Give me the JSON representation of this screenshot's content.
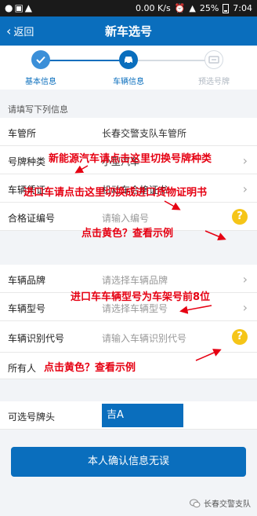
{
  "status_bar": {
    "left_icons": "●▣▲",
    "speed": "0.00 K/s",
    "battery": "25%",
    "time": "7:04"
  },
  "nav": {
    "back_label": "返回",
    "title": "新车选号"
  },
  "steps": [
    {
      "label": "基本信息",
      "state": "done"
    },
    {
      "label": "车辆信息",
      "state": "active"
    },
    {
      "label": "预选号牌",
      "state": "pending"
    }
  ],
  "section_title": "请填写下列信息",
  "rows": [
    {
      "label": "车管所",
      "value": "长春交警支队车管所",
      "placeholder": ""
    },
    {
      "label": "号牌种类",
      "value": "小型汽车",
      "placeholder": ""
    },
    {
      "label": "车辆凭证",
      "value": "机动车合格证书",
      "placeholder": ""
    },
    {
      "label": "合格证编号",
      "value": "",
      "placeholder": "请输入编号"
    },
    {
      "label": "车辆品牌",
      "value": "",
      "placeholder": "请选择车辆品牌"
    },
    {
      "label": "车辆型号",
      "value": "",
      "placeholder": "请选择车辆型号"
    },
    {
      "label": "车辆识别代号",
      "value": "",
      "placeholder": "请输入车辆识别代号"
    },
    {
      "label": "所有人",
      "value": "",
      "placeholder": ""
    },
    {
      "label": "可选号牌头",
      "value": "吉A",
      "placeholder": ""
    }
  ],
  "help_icon": "?",
  "annotations": [
    "新能源汽车请点击这里切换号牌种类",
    "进口车请点击这里切换成进口货物证明书",
    "点击黄色？查看示例",
    "进口车车辆型号为车架号前8位",
    "点击黄色？查看示例"
  ],
  "confirm_button": "本人确认信息无误",
  "watermark": "长春交警支队",
  "colors": {
    "primary": "#0a6ebd",
    "annotation": "#e60012",
    "help": "#f5c518"
  }
}
